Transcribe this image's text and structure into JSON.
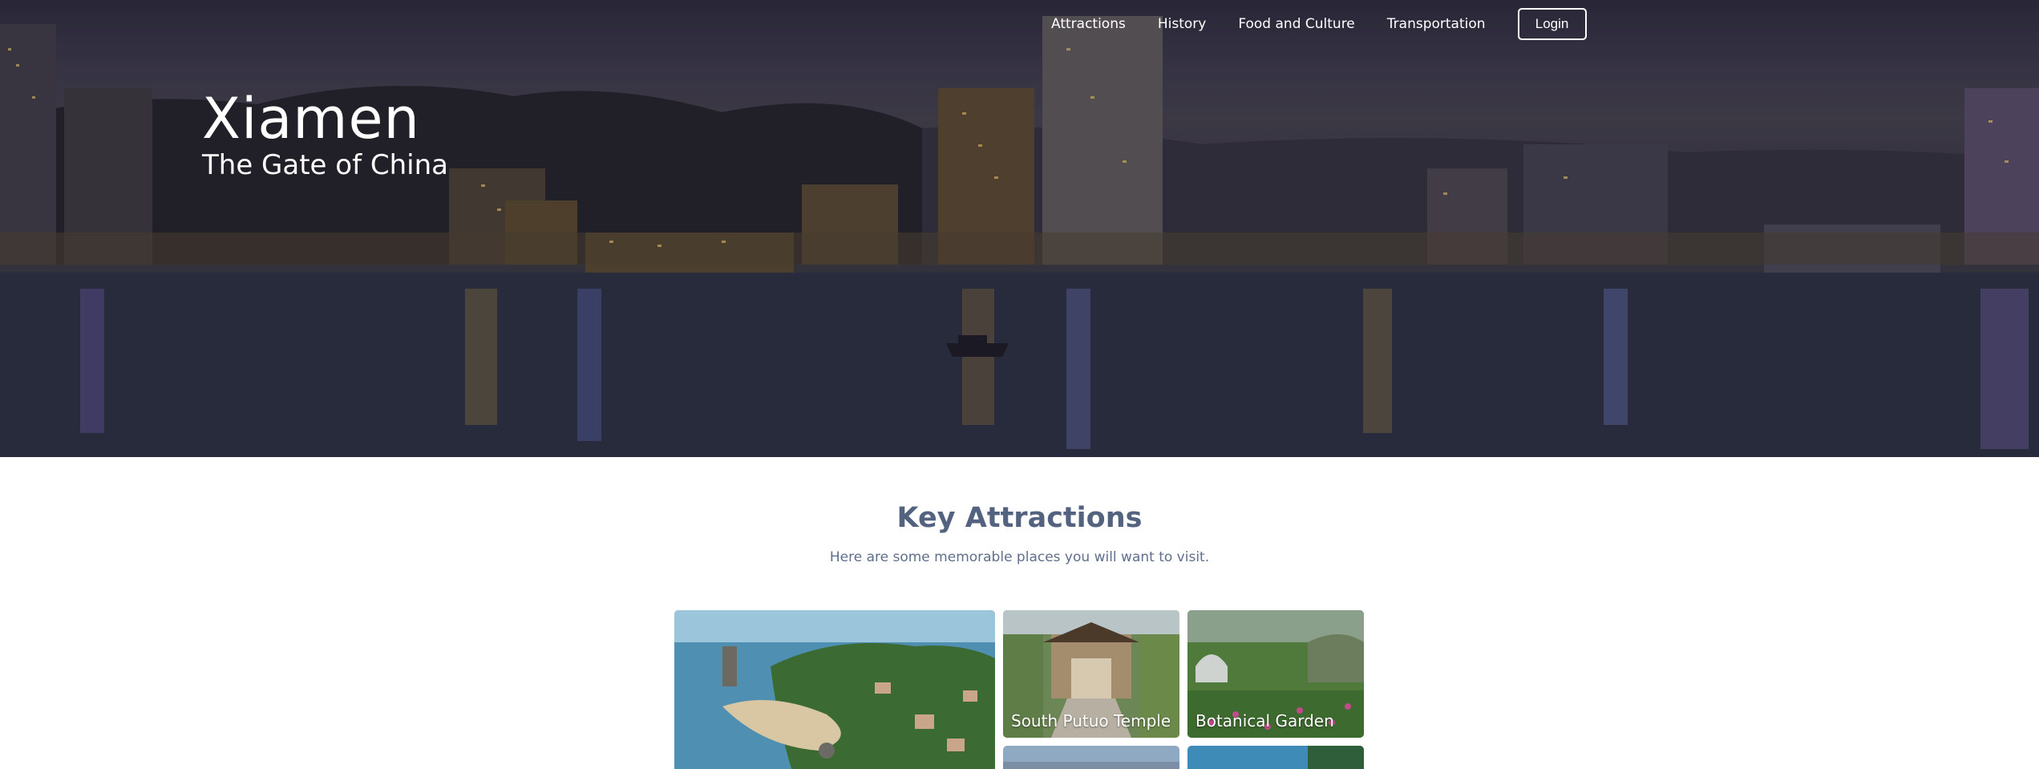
{
  "hero": {
    "title": "Xiamen",
    "subtitle": "The Gate of China"
  },
  "nav": {
    "items": [
      "Attractions",
      "History",
      "Food and Culture",
      "Transportation"
    ],
    "login_label": "Login"
  },
  "attractions": {
    "title": "Key Attractions",
    "subtitle": "Here are some memorable places you will want to visit.",
    "cards": [
      {
        "label": ""
      },
      {
        "label": "South Putuo Temple"
      },
      {
        "label": "Botanical Garden"
      },
      {
        "label": ""
      },
      {
        "label": ""
      }
    ]
  },
  "colors": {
    "heading": "#52627f",
    "subtext": "#5f6f8c",
    "nav_text": "#ffffff"
  }
}
